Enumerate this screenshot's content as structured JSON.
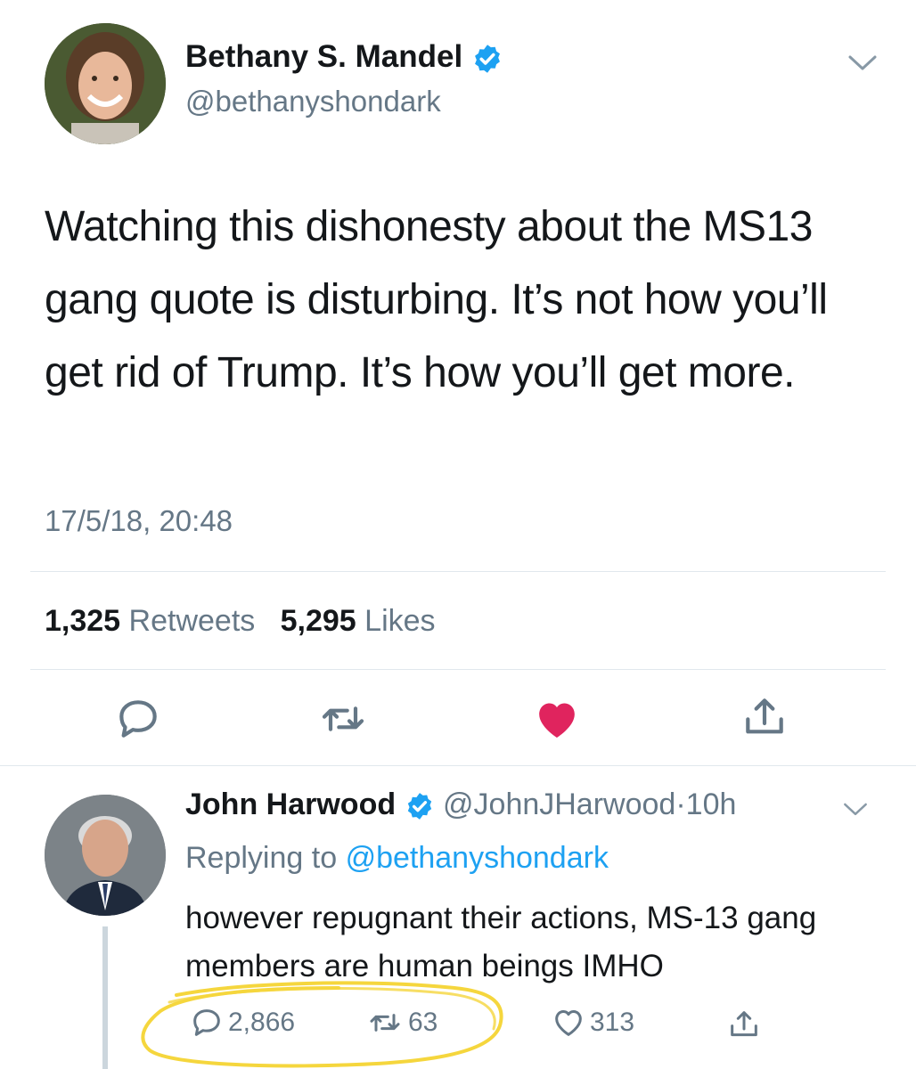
{
  "main_tweet": {
    "author_name": "Bethany S. Mandel",
    "handle": "@bethanyshondark",
    "text": "Watching this dishonesty about the MS13 gang quote is disturbing. It’s not how you’ll get rid of Trump. It’s how you’ll get more.",
    "timestamp": "17/5/18, 20:48",
    "retweet_count": "1,325",
    "retweet_label": "Retweets",
    "like_count": "5,295",
    "like_label": "Likes",
    "liked": true,
    "icons": [
      "verified-badge-icon",
      "chevron-down-icon",
      "reply-icon",
      "retweet-icon",
      "heart-filled-icon",
      "share-icon"
    ]
  },
  "reply_tweet": {
    "author_name": "John Harwood",
    "handle": "@JohnJHarwood",
    "separator": "·",
    "time_ago": "10h",
    "replying_prefix": "Replying to",
    "replying_to": "@bethanyshondark",
    "text": "however repugnant their actions, MS-13 gang members are human beings IMHO",
    "reply_count": "2,866",
    "retweet_count": "63",
    "like_count": "313"
  },
  "colors": {
    "accent_blue": "#1da1f2",
    "like_red": "#e0245e",
    "secondary_text": "#657786",
    "highlight_yellow": "#f5d63d"
  }
}
